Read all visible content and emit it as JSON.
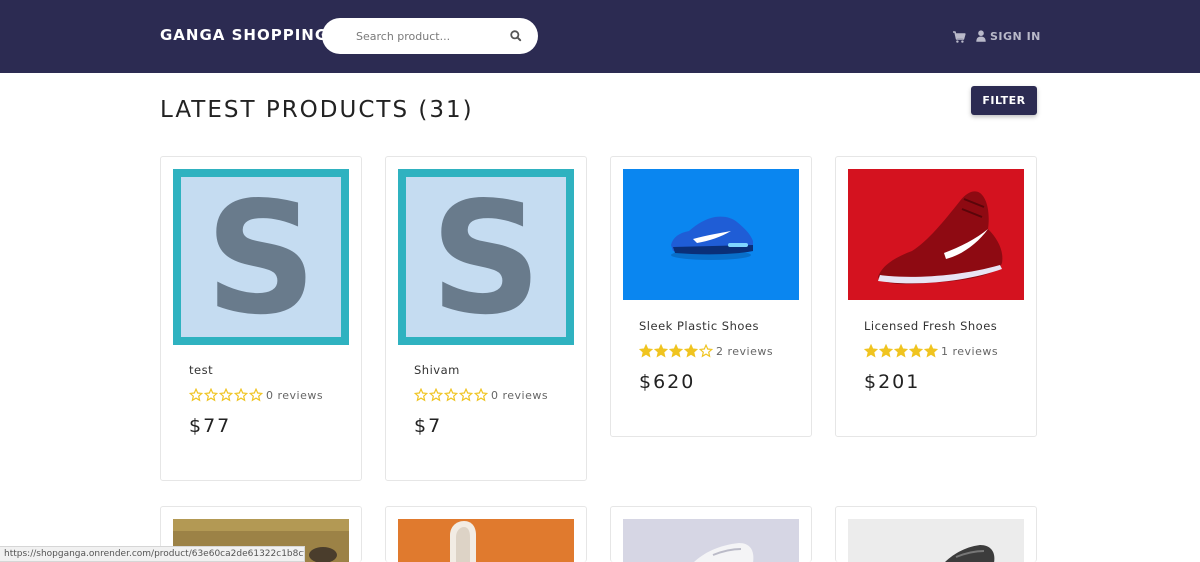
{
  "navbar": {
    "brand": "GANGA SHOPPING",
    "search_placeholder": "Search product...",
    "search_icon": "search-icon",
    "cart_icon": "cart-icon",
    "user_icon": "user-icon",
    "signin_label": "SIGN IN",
    "bg_color": "#2c2b52"
  },
  "main": {
    "title": "LATEST PRODUCTS (31)",
    "filter_label": "FILTER"
  },
  "products": [
    {
      "name": "test",
      "rating": 0,
      "reviews": "0 reviews",
      "price": "$77",
      "image": "letter-s-placeholder"
    },
    {
      "name": "Shivam",
      "rating": 0,
      "reviews": "0 reviews",
      "price": "$7",
      "image": "letter-s-placeholder"
    },
    {
      "name": "Sleek Plastic Shoes",
      "rating": 4,
      "reviews": "2 reviews",
      "price": "$620",
      "image": "blue-sneaker"
    },
    {
      "name": "Licensed Fresh Shoes",
      "rating": 5,
      "reviews": "1 reviews",
      "price": "$201",
      "image": "red-sneaker"
    },
    {
      "image": "dark-shoe-partial"
    },
    {
      "image": "orange-bg-shoe-partial"
    },
    {
      "image": "grey-sneaker-partial"
    },
    {
      "image": "black-sneaker-partial"
    }
  ],
  "colors": {
    "star": "#f0c420",
    "accent": "#2c2b52"
  },
  "status_bar": {
    "url": "https://shopganga.onrender.com/product/63e60ca2de61322c1b8cf1f2"
  }
}
